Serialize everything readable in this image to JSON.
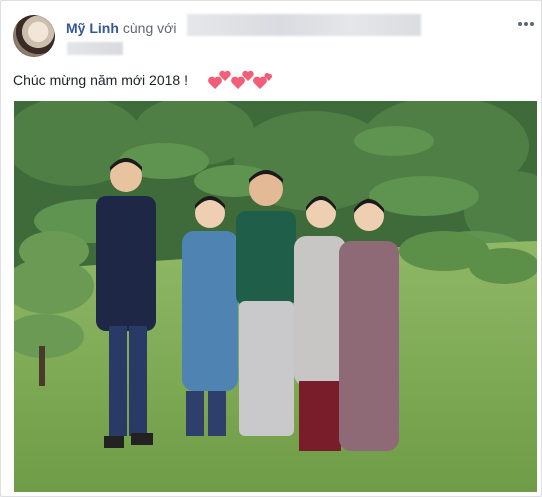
{
  "post": {
    "author_name": "Mỹ Linh",
    "with_text": "cùng với",
    "more_icon": "ellipsis-icon",
    "status_text": "Chúc mừng năm mới 2018 !",
    "hearts_icon": "heart-emoji-icon",
    "photo_description_icon": "photo"
  },
  "colors": {
    "link": "#365899",
    "text": "#1d2129",
    "muted": "#606770",
    "heart": "#f25d78"
  }
}
